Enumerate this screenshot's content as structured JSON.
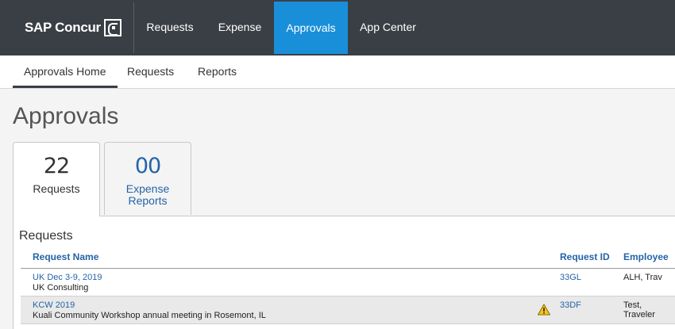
{
  "app": {
    "logo_text": "SAP Concur"
  },
  "topnav": {
    "items": [
      {
        "label": "Requests"
      },
      {
        "label": "Expense"
      },
      {
        "label": "Approvals"
      },
      {
        "label": "App Center"
      }
    ],
    "active": "Approvals",
    "active_color": "#1a8fd9",
    "bar_color": "#3a3f45"
  },
  "subnav": {
    "items": [
      {
        "label": "Approvals Home"
      },
      {
        "label": "Requests"
      },
      {
        "label": "Reports"
      }
    ],
    "active": "Approvals Home"
  },
  "page": {
    "title": "Approvals"
  },
  "tabs": [
    {
      "count": "22",
      "label": "Requests",
      "active": true
    },
    {
      "count": "00",
      "label_line1": "Expense",
      "label_line2": "Reports",
      "active": false
    }
  ],
  "requests_section": {
    "title": "Requests",
    "columns": {
      "name": "Request Name",
      "id": "Request ID",
      "employee": "Employee"
    },
    "rows": [
      {
        "name": "UK Dec 3-9, 2019",
        "description": "UK Consulting",
        "id": "33GL",
        "employee": "ALH, Trav",
        "warning": false
      },
      {
        "name": "KCW 2019",
        "description": "Kuali Community Workshop annual meeting in Rosemont, IL",
        "id": "33DF",
        "employee": "Test, Traveler",
        "warning": true,
        "warning_icon": "warning-triangle-icon",
        "warning_color": "#f5c518"
      }
    ]
  }
}
